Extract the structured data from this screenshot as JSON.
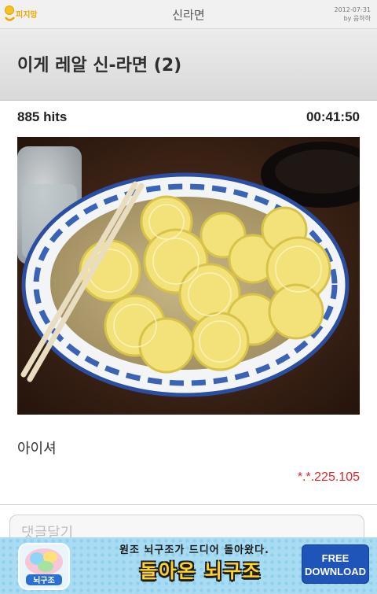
{
  "top_bar": {
    "logo_text": "피지망",
    "title": "신라면",
    "date": "2012-07-31",
    "author": "by 음하하"
  },
  "post": {
    "title": "이게 레알 신-라면 (2)",
    "hits": "885 hits",
    "time": "00:41:50",
    "body": "아이셔",
    "ip": "*.*.225.105"
  },
  "comment": {
    "placeholder": "댓글달기"
  },
  "ad": {
    "headline": "원조 뇌구조가 드디어 돌아왔다.",
    "title": "돌아온 뇌구조",
    "app_name": "뇌구조",
    "button_line1": "FREE",
    "button_line2": "DOWNLOAD",
    "colors": {
      "background": "#a9dcf3",
      "button": "#1f54b8",
      "title": "#ffd22a"
    }
  },
  "photo": {
    "icon": "photo-lemon-ramen"
  }
}
